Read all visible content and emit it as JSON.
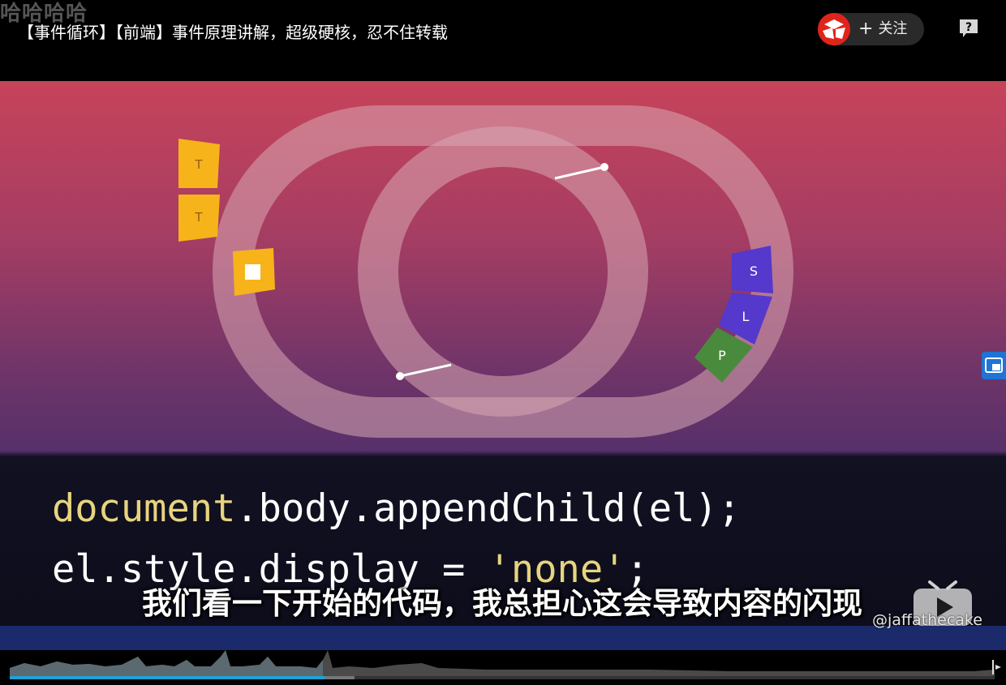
{
  "danmaku": {
    "ghost_text": "哈哈哈哈"
  },
  "header": {
    "title": "【事件循环】【前端】事件原理讲解，超级硬核，忍不住转载",
    "follow_label": "关注",
    "follow_icon": "plus-icon",
    "help_icon": "help-icon"
  },
  "diagram": {
    "task_blocks": [
      "T",
      "T"
    ],
    "render_labels": [
      "S",
      "L",
      "P"
    ],
    "colors": {
      "task": "#f7b31a",
      "style": "#5538cc",
      "layout": "#5538cc",
      "paint": "#4a8a3c",
      "loop": "#c99aa9"
    }
  },
  "code": {
    "line1_obj": "document",
    "line1_rest": ".body.appendChild(el);",
    "line2_pre": "el.style.display = ",
    "line2_str": "'none'",
    "line2_post": ";"
  },
  "subtitle": {
    "text": "我们看一下开始的代码，我总担心这会导致内容的闪现"
  },
  "watermark": {
    "text": "@jaffathecake"
  },
  "player": {
    "progress_percent": 32,
    "buffered_percent": 35,
    "accent_color": "#1fa2d6"
  }
}
